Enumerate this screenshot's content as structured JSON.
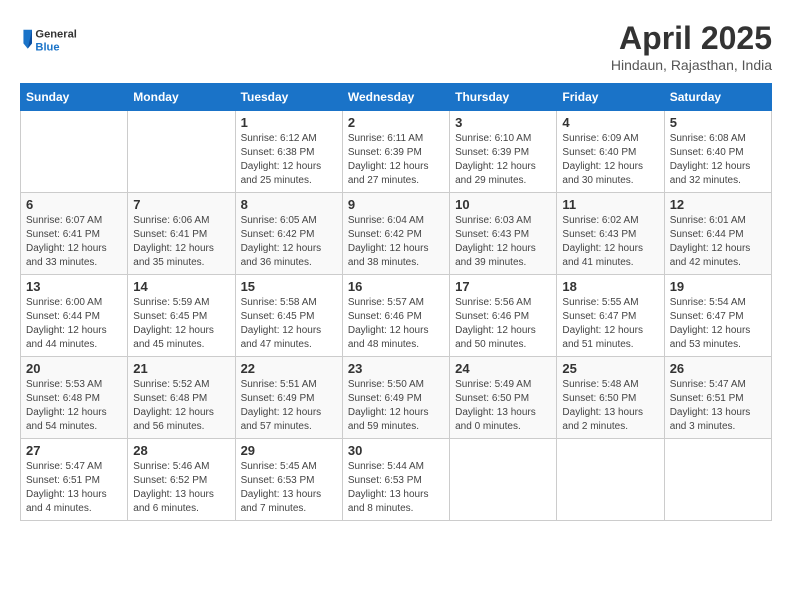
{
  "logo": {
    "line1": "General",
    "line2": "Blue"
  },
  "title": "April 2025",
  "subtitle": "Hindaun, Rajasthan, India",
  "days_header": [
    "Sunday",
    "Monday",
    "Tuesday",
    "Wednesday",
    "Thursday",
    "Friday",
    "Saturday"
  ],
  "weeks": [
    [
      {
        "num": "",
        "sunrise": "",
        "sunset": "",
        "daylight": ""
      },
      {
        "num": "",
        "sunrise": "",
        "sunset": "",
        "daylight": ""
      },
      {
        "num": "1",
        "sunrise": "Sunrise: 6:12 AM",
        "sunset": "Sunset: 6:38 PM",
        "daylight": "Daylight: 12 hours and 25 minutes."
      },
      {
        "num": "2",
        "sunrise": "Sunrise: 6:11 AM",
        "sunset": "Sunset: 6:39 PM",
        "daylight": "Daylight: 12 hours and 27 minutes."
      },
      {
        "num": "3",
        "sunrise": "Sunrise: 6:10 AM",
        "sunset": "Sunset: 6:39 PM",
        "daylight": "Daylight: 12 hours and 29 minutes."
      },
      {
        "num": "4",
        "sunrise": "Sunrise: 6:09 AM",
        "sunset": "Sunset: 6:40 PM",
        "daylight": "Daylight: 12 hours and 30 minutes."
      },
      {
        "num": "5",
        "sunrise": "Sunrise: 6:08 AM",
        "sunset": "Sunset: 6:40 PM",
        "daylight": "Daylight: 12 hours and 32 minutes."
      }
    ],
    [
      {
        "num": "6",
        "sunrise": "Sunrise: 6:07 AM",
        "sunset": "Sunset: 6:41 PM",
        "daylight": "Daylight: 12 hours and 33 minutes."
      },
      {
        "num": "7",
        "sunrise": "Sunrise: 6:06 AM",
        "sunset": "Sunset: 6:41 PM",
        "daylight": "Daylight: 12 hours and 35 minutes."
      },
      {
        "num": "8",
        "sunrise": "Sunrise: 6:05 AM",
        "sunset": "Sunset: 6:42 PM",
        "daylight": "Daylight: 12 hours and 36 minutes."
      },
      {
        "num": "9",
        "sunrise": "Sunrise: 6:04 AM",
        "sunset": "Sunset: 6:42 PM",
        "daylight": "Daylight: 12 hours and 38 minutes."
      },
      {
        "num": "10",
        "sunrise": "Sunrise: 6:03 AM",
        "sunset": "Sunset: 6:43 PM",
        "daylight": "Daylight: 12 hours and 39 minutes."
      },
      {
        "num": "11",
        "sunrise": "Sunrise: 6:02 AM",
        "sunset": "Sunset: 6:43 PM",
        "daylight": "Daylight: 12 hours and 41 minutes."
      },
      {
        "num": "12",
        "sunrise": "Sunrise: 6:01 AM",
        "sunset": "Sunset: 6:44 PM",
        "daylight": "Daylight: 12 hours and 42 minutes."
      }
    ],
    [
      {
        "num": "13",
        "sunrise": "Sunrise: 6:00 AM",
        "sunset": "Sunset: 6:44 PM",
        "daylight": "Daylight: 12 hours and 44 minutes."
      },
      {
        "num": "14",
        "sunrise": "Sunrise: 5:59 AM",
        "sunset": "Sunset: 6:45 PM",
        "daylight": "Daylight: 12 hours and 45 minutes."
      },
      {
        "num": "15",
        "sunrise": "Sunrise: 5:58 AM",
        "sunset": "Sunset: 6:45 PM",
        "daylight": "Daylight: 12 hours and 47 minutes."
      },
      {
        "num": "16",
        "sunrise": "Sunrise: 5:57 AM",
        "sunset": "Sunset: 6:46 PM",
        "daylight": "Daylight: 12 hours and 48 minutes."
      },
      {
        "num": "17",
        "sunrise": "Sunrise: 5:56 AM",
        "sunset": "Sunset: 6:46 PM",
        "daylight": "Daylight: 12 hours and 50 minutes."
      },
      {
        "num": "18",
        "sunrise": "Sunrise: 5:55 AM",
        "sunset": "Sunset: 6:47 PM",
        "daylight": "Daylight: 12 hours and 51 minutes."
      },
      {
        "num": "19",
        "sunrise": "Sunrise: 5:54 AM",
        "sunset": "Sunset: 6:47 PM",
        "daylight": "Daylight: 12 hours and 53 minutes."
      }
    ],
    [
      {
        "num": "20",
        "sunrise": "Sunrise: 5:53 AM",
        "sunset": "Sunset: 6:48 PM",
        "daylight": "Daylight: 12 hours and 54 minutes."
      },
      {
        "num": "21",
        "sunrise": "Sunrise: 5:52 AM",
        "sunset": "Sunset: 6:48 PM",
        "daylight": "Daylight: 12 hours and 56 minutes."
      },
      {
        "num": "22",
        "sunrise": "Sunrise: 5:51 AM",
        "sunset": "Sunset: 6:49 PM",
        "daylight": "Daylight: 12 hours and 57 minutes."
      },
      {
        "num": "23",
        "sunrise": "Sunrise: 5:50 AM",
        "sunset": "Sunset: 6:49 PM",
        "daylight": "Daylight: 12 hours and 59 minutes."
      },
      {
        "num": "24",
        "sunrise": "Sunrise: 5:49 AM",
        "sunset": "Sunset: 6:50 PM",
        "daylight": "Daylight: 13 hours and 0 minutes."
      },
      {
        "num": "25",
        "sunrise": "Sunrise: 5:48 AM",
        "sunset": "Sunset: 6:50 PM",
        "daylight": "Daylight: 13 hours and 2 minutes."
      },
      {
        "num": "26",
        "sunrise": "Sunrise: 5:47 AM",
        "sunset": "Sunset: 6:51 PM",
        "daylight": "Daylight: 13 hours and 3 minutes."
      }
    ],
    [
      {
        "num": "27",
        "sunrise": "Sunrise: 5:47 AM",
        "sunset": "Sunset: 6:51 PM",
        "daylight": "Daylight: 13 hours and 4 minutes."
      },
      {
        "num": "28",
        "sunrise": "Sunrise: 5:46 AM",
        "sunset": "Sunset: 6:52 PM",
        "daylight": "Daylight: 13 hours and 6 minutes."
      },
      {
        "num": "29",
        "sunrise": "Sunrise: 5:45 AM",
        "sunset": "Sunset: 6:53 PM",
        "daylight": "Daylight: 13 hours and 7 minutes."
      },
      {
        "num": "30",
        "sunrise": "Sunrise: 5:44 AM",
        "sunset": "Sunset: 6:53 PM",
        "daylight": "Daylight: 13 hours and 8 minutes."
      },
      {
        "num": "",
        "sunrise": "",
        "sunset": "",
        "daylight": ""
      },
      {
        "num": "",
        "sunrise": "",
        "sunset": "",
        "daylight": ""
      },
      {
        "num": "",
        "sunrise": "",
        "sunset": "",
        "daylight": ""
      }
    ]
  ]
}
